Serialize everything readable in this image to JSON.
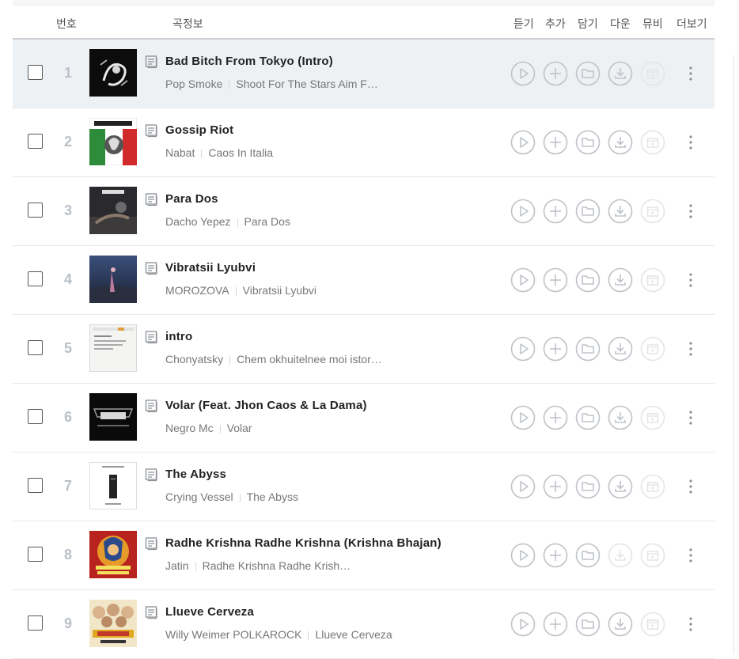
{
  "header": {
    "number": "번호",
    "song_info": "곡정보",
    "play": "듣기",
    "add": "추가",
    "save": "담기",
    "download": "다운",
    "mv": "뮤비",
    "more": "더보기"
  },
  "tracks": [
    {
      "rank": "1",
      "title": "Bad Bitch From Tokyo (Intro)",
      "artist": "Pop Smoke",
      "album": "Shoot For The Stars Aim F…",
      "selected": true,
      "download_enabled": true
    },
    {
      "rank": "2",
      "title": "Gossip Riot",
      "artist": "Nabat",
      "album": "Caos In Italia",
      "selected": false,
      "download_enabled": true
    },
    {
      "rank": "3",
      "title": "Para Dos",
      "artist": "Dacho Yepez",
      "album": "Para Dos",
      "selected": false,
      "download_enabled": true
    },
    {
      "rank": "4",
      "title": "Vibratsii Lyubvi",
      "artist": "MOROZOVA",
      "album": "Vibratsii Lyubvi",
      "selected": false,
      "download_enabled": true
    },
    {
      "rank": "5",
      "title": "intro",
      "artist": "Chonyatsky",
      "album": "Chem okhuitelnee moi istor…",
      "selected": false,
      "download_enabled": true
    },
    {
      "rank": "6",
      "title": "Volar (Feat. Jhon Caos & La Dama)",
      "artist": "Negro Mc",
      "album": "Volar",
      "selected": false,
      "download_enabled": true
    },
    {
      "rank": "7",
      "title": "The Abyss",
      "artist": "Crying Vessel",
      "album": "The Abyss",
      "selected": false,
      "download_enabled": true
    },
    {
      "rank": "8",
      "title": "Radhe Krishna Radhe Krishna (Krishna Bhajan)",
      "artist": "Jatin",
      "album": "Radhe Krishna Radhe Krish…",
      "selected": false,
      "download_enabled": false
    },
    {
      "rank": "9",
      "title": "Llueve Cerveza",
      "artist": "Willy Weimer POLKAROCK",
      "album": "Llueve Cerveza",
      "selected": false,
      "download_enabled": true
    }
  ],
  "icons": {
    "lyrics": "lyrics-icon",
    "play": "play-circle-icon",
    "add": "plus-circle-icon",
    "save": "folder-circle-icon",
    "download": "download-circle-icon",
    "mv": "mv-circle-icon",
    "more": "kebab-icon"
  },
  "colors": {
    "row_selected": "#eef1f4",
    "icon_active": "#bfc3c8",
    "icon_disabled": "#e3e5e8",
    "title": "#222222",
    "meta": "#777777",
    "rank": "#bbc0c6"
  }
}
